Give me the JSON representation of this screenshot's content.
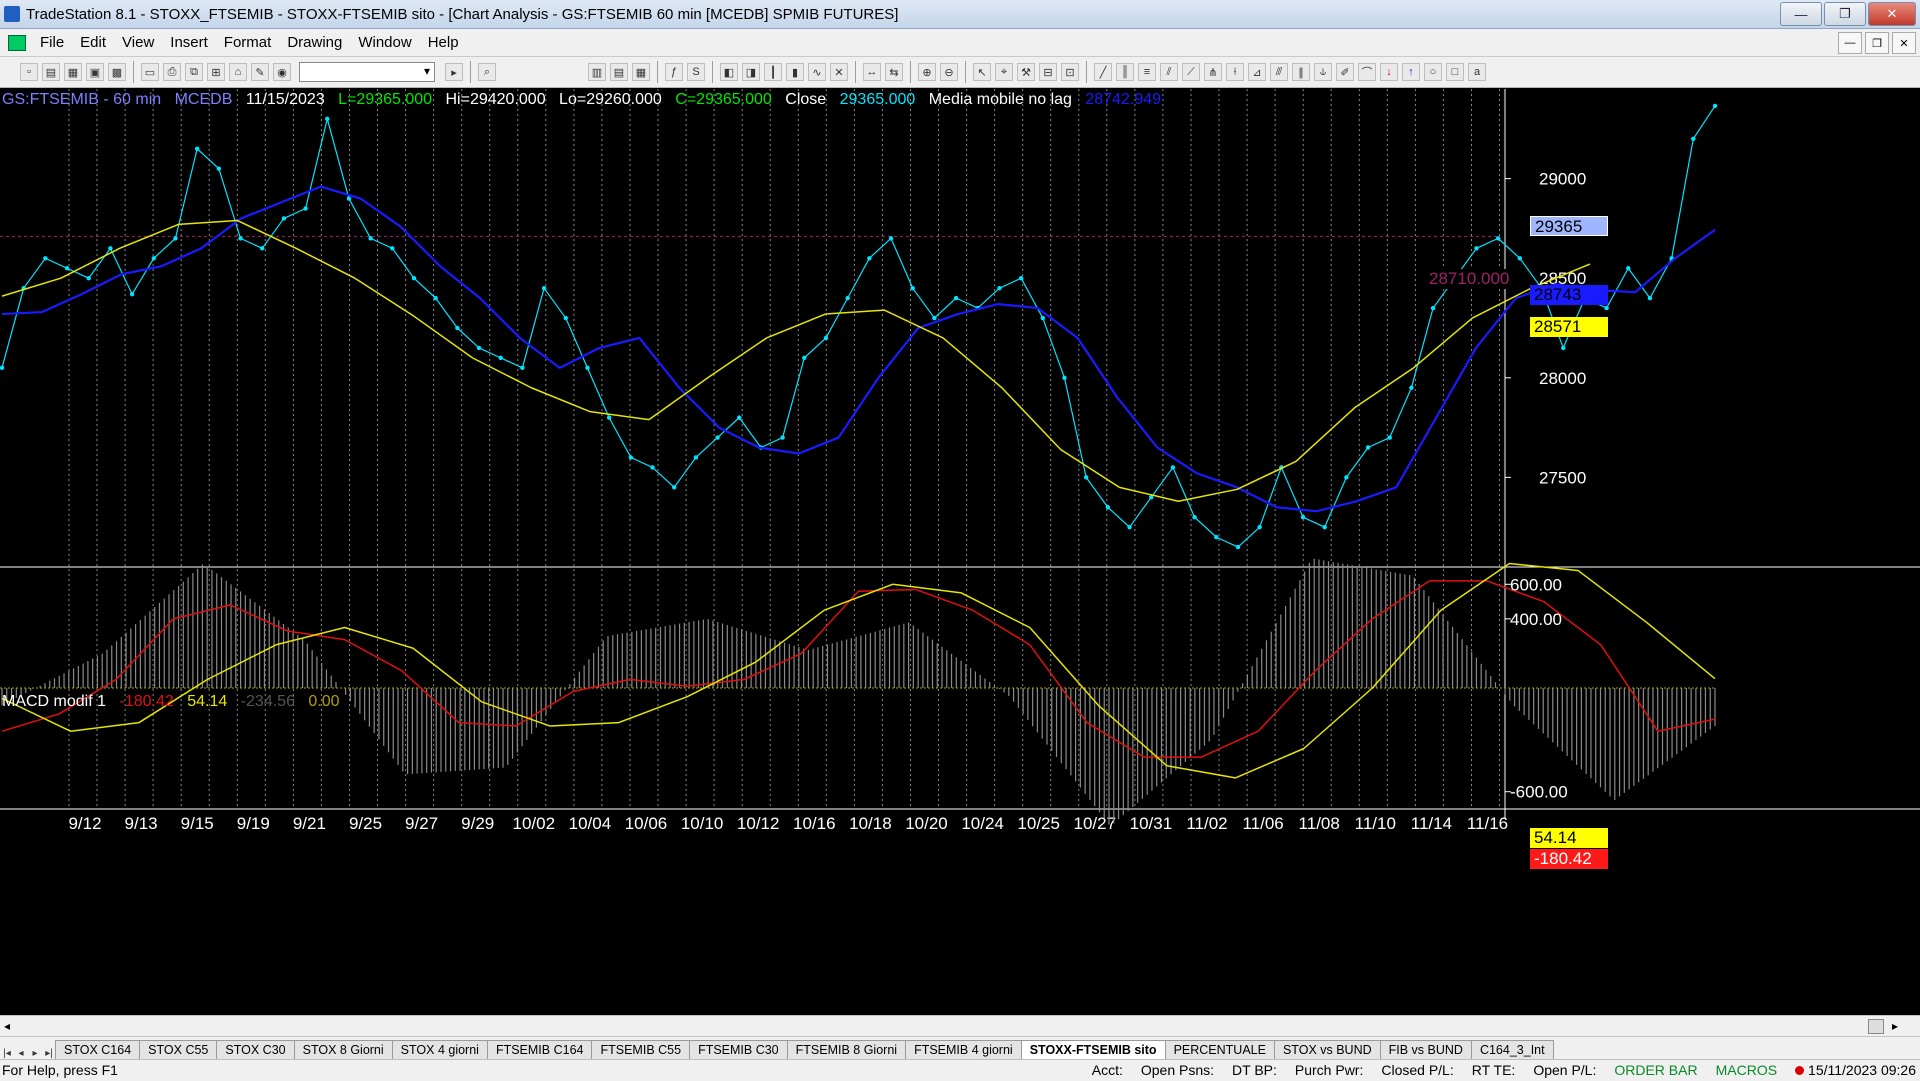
{
  "window": {
    "title": "TradeStation 8.1 - STOXX_FTSEMIB - STOXX-FTSEMIB sito - [Chart Analysis - GS:FTSEMIB  60 min  [MCEDB] SPMIB FUTURES]",
    "controls": [
      "—",
      "❐",
      "✕"
    ]
  },
  "menu": [
    "File",
    "Edit",
    "View",
    "Insert",
    "Format",
    "Drawing",
    "Window",
    "Help"
  ],
  "chart_header": {
    "symbol": "GS:FTSEMIB - 60 min",
    "exchange": "MCEDB",
    "date": "11/15/2023",
    "last": "L=29365.000",
    "high": "Hi=29420.000",
    "low": "Lo=29260.000",
    "close": "C=29365.000",
    "close_label": "Close",
    "close_value": "29365.000",
    "ma_label": "Media mobile no lag",
    "ma_value": "28742.949"
  },
  "price_axis": {
    "labels": [
      "29000",
      "28500",
      "28000",
      "27500"
    ],
    "last_price": "29365",
    "blue_ma": "28743",
    "yellow_ma": "28571",
    "hline_label": "28710.000"
  },
  "macd_header": {
    "name": "MACD modif 1",
    "v1": "-180.42",
    "v2": "54.14",
    "v3": "-234.56",
    "v4": "0.00"
  },
  "macd_axis": {
    "labels": [
      "600.00",
      "400.00",
      "-600.00"
    ],
    "box_yellow": "54.14",
    "box_red": "-180.42",
    "hidden": "0.00",
    "hidden2": "-234.56"
  },
  "x_axis": [
    "9/12",
    "9/13",
    "9/15",
    "9/19",
    "9/21",
    "9/25",
    "9/27",
    "9/29",
    "10/02",
    "10/04",
    "10/06",
    "10/10",
    "10/12",
    "10/16",
    "10/18",
    "10/20",
    "10/24",
    "10/25",
    "10/27",
    "10/31",
    "11/02",
    "11/06",
    "11/08",
    "11/10",
    "11/14",
    "11/16"
  ],
  "tabs": [
    "STOX C164",
    "STOX C55",
    "STOX  C30",
    "STOX  8 Giorni",
    "STOX 4 giorni",
    "FTSEMIB C164",
    "FTSEMIB C55",
    "FTSEMIB C30",
    "FTSEMIB  8 Giorni",
    "FTSEMIB  4 giorni",
    "STOXX-FTSEMIB sito",
    "PERCENTUALE",
    "STOX vs BUND",
    "FIB vs BUND",
    "C164_3_Int"
  ],
  "active_tab": "STOXX-FTSEMIB sito",
  "status": {
    "help": "For Help, press F1",
    "acct": "Acct:",
    "open_psns": "Open Psns:",
    "dt_bp": "DT BP:",
    "purch_pwr": "Purch Pwr:",
    "closed_pl": "Closed P/L:",
    "rt_te": "RT TE:",
    "open_pl": "Open P/L:",
    "order_bar": "ORDER BAR",
    "macros": "MACROS",
    "datetime": "15/11/2023 09:26"
  },
  "colors": {
    "price": "#00e5ff",
    "blue_ma": "#1a1aff",
    "yellow_ma": "#e6e600",
    "macd_red": "#e01010",
    "macd_yellow": "#e6e600",
    "histogram": "#8a8a8a",
    "hline": "#a0206a"
  },
  "chart_data": [
    {
      "type": "line",
      "title": "GS:FTSEMIB - 60 min",
      "ylim": [
        27050,
        29450
      ],
      "x_labels": [
        "9/12",
        "9/13",
        "9/15",
        "9/19",
        "9/21",
        "9/25",
        "9/27",
        "9/29",
        "10/02",
        "10/04",
        "10/06",
        "10/10",
        "10/12",
        "10/16",
        "10/18",
        "10/20",
        "10/24",
        "10/25",
        "10/27",
        "10/31",
        "11/02",
        "11/06",
        "11/08",
        "11/10",
        "11/14",
        "11/16"
      ],
      "series": [
        {
          "values": [
            28050,
            28450,
            28600,
            28550,
            28500,
            28650,
            28420,
            28600,
            28700,
            29150,
            29050,
            28700,
            28650,
            28800,
            28850,
            29300,
            28900,
            28700,
            28650,
            28500,
            28400,
            28250,
            28150,
            28100,
            28050,
            28450,
            28300,
            28050,
            27800,
            27600,
            27550,
            27450,
            27600,
            27700,
            27800,
            27650,
            27700,
            28100,
            28200,
            28400,
            28600,
            28700,
            28450,
            28300,
            28400,
            28350,
            28450,
            28500,
            28300,
            28000,
            27500,
            27350,
            27250,
            27400,
            27550,
            27300,
            27200,
            27150,
            27250,
            27550,
            27300,
            27250,
            27500,
            27650,
            27700,
            27950,
            28350,
            28500,
            28650,
            28700,
            28600,
            28450,
            28150,
            28400,
            28350,
            28550,
            28400,
            28600,
            29200,
            29365
          ]
        },
        {
          "values": [
            28320,
            28330,
            28420,
            28520,
            28560,
            28650,
            28800,
            28880,
            28960,
            28900,
            28760,
            28560,
            28400,
            28200,
            28050,
            28150,
            28200,
            27950,
            27750,
            27650,
            27620,
            27700,
            28000,
            28250,
            28320,
            28370,
            28350,
            28200,
            27900,
            27650,
            27520,
            27450,
            27350,
            27330,
            27380,
            27450,
            27800,
            28150,
            28400,
            28470,
            28440,
            28430,
            28600,
            28743
          ]
        },
        {
          "values": [
            28410,
            28500,
            28650,
            28770,
            28790,
            28650,
            28500,
            28310,
            28100,
            27950,
            27830,
            27790,
            28000,
            28200,
            28320,
            28340,
            28200,
            27950,
            27640,
            27450,
            27380,
            27440,
            27580,
            27850,
            28050,
            28300,
            28450,
            28571
          ]
        }
      ]
    },
    {
      "type": "line",
      "title": "MACD modif 1",
      "ylim": [
        -700,
        700
      ],
      "series": [
        {
          "values": [
            -250,
            -150,
            50,
            400,
            480,
            330,
            280,
            100,
            -200,
            -220,
            -20,
            50,
            10,
            50,
            200,
            560,
            570,
            450,
            250,
            -200,
            -400,
            -400,
            -250,
            100,
            400,
            620,
            620,
            500,
            250,
            -250,
            -180
          ]
        },
        {
          "values": [
            -60,
            -250,
            -200,
            50,
            250,
            350,
            230,
            -80,
            -220,
            -200,
            -50,
            150,
            450,
            600,
            550,
            350,
            -100,
            -450,
            -520,
            -350,
            0,
            450,
            720,
            680,
            380,
            54
          ]
        },
        {
          "values": [
            -100,
            200,
            720,
            280,
            -500,
            -460,
            300,
            400,
            220,
            380,
            -50,
            -800,
            -300,
            750,
            650,
            -100,
            -650,
            -220
          ]
        },
        {
          "values": [
            0
          ]
        }
      ]
    }
  ]
}
